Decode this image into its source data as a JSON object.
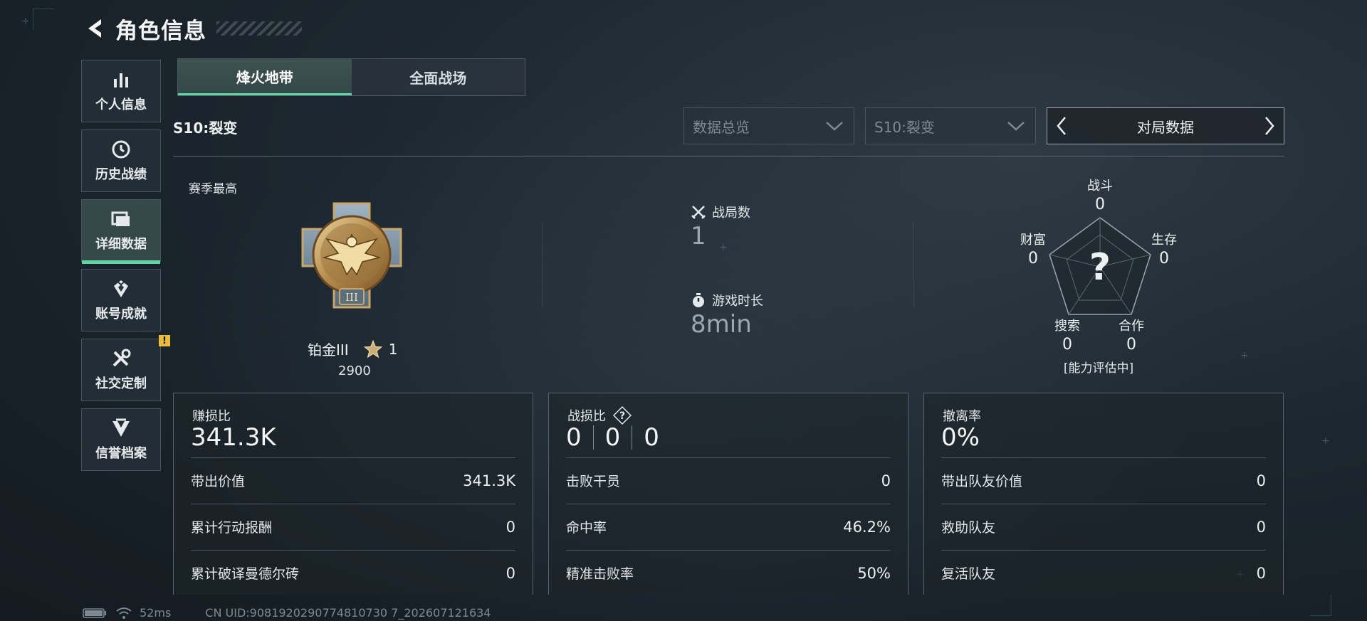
{
  "header": {
    "title": "角色信息"
  },
  "sidebar": {
    "items": [
      {
        "label": "个人信息",
        "icon": "bar-chart-icon"
      },
      {
        "label": "历史战绩",
        "icon": "history-clock-icon"
      },
      {
        "label": "详细数据",
        "icon": "folder-icon",
        "active": true
      },
      {
        "label": "账号成就",
        "icon": "achievement-icon"
      },
      {
        "label": "社交定制",
        "icon": "tools-icon",
        "badge": "!"
      },
      {
        "label": "信誉档案",
        "icon": "credit-shield-icon"
      }
    ]
  },
  "tabs": [
    {
      "label": "烽火地带",
      "active": true
    },
    {
      "label": "全面战场",
      "active": false
    }
  ],
  "season_label": "S10:裂变",
  "filters": {
    "overview": "数据总览",
    "season": "S10:裂变",
    "pager": "对局数据"
  },
  "season_best": {
    "label": "赛季最高",
    "rank": "铂金III",
    "stars": "1",
    "score": "2900",
    "medal_numeral": "III"
  },
  "match_stats": {
    "matches_label": "战局数",
    "matches_value": "1",
    "playtime_label": "游戏时长",
    "playtime_value": "8min"
  },
  "radar": {
    "center": "?",
    "combat_label": "战斗",
    "combat_value": "0",
    "survival_label": "生存",
    "survival_value": "0",
    "wealth_label": "财富",
    "wealth_value": "0",
    "search_label": "搜索",
    "search_value": "0",
    "coop_label": "合作",
    "coop_value": "0",
    "status": "[能力评估中]"
  },
  "cards": {
    "profit": {
      "label": "赚损比",
      "value": "341.3K",
      "rows": [
        {
          "label": "带出价值",
          "value": "341.3K"
        },
        {
          "label": "累计行动报酬",
          "value": "0"
        },
        {
          "label": "累计破译曼德尔砖",
          "value": "0"
        }
      ]
    },
    "combat": {
      "label": "战损比",
      "values": [
        "0",
        "0",
        "0"
      ],
      "rows": [
        {
          "label": "击败干员",
          "value": "0"
        },
        {
          "label": "命中率",
          "value": "46.2%"
        },
        {
          "label": "精准击败率",
          "value": "50%"
        }
      ]
    },
    "evac": {
      "label": "撤离率",
      "value": "0%",
      "rows": [
        {
          "label": "带出队友价值",
          "value": "0"
        },
        {
          "label": "救助队友",
          "value": "0"
        },
        {
          "label": "复活队友",
          "value": "0"
        }
      ]
    }
  },
  "footer": {
    "ping": "52ms",
    "uid": "CN UID:9081920290774810730 7_202607121634"
  },
  "colors": {
    "accent": "#5ed6a4",
    "warn": "#e9bd3a"
  }
}
